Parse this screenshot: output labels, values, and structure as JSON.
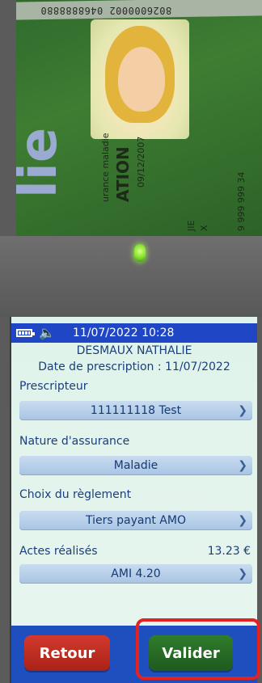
{
  "card": {
    "top_number": "8026000002 0468888880",
    "big_text": "lie",
    "rotated_texts": [
      "urance maladie",
      "ATION",
      "09/12/2007",
      "JIE",
      "X",
      "9 999 999 34"
    ]
  },
  "status_bar": {
    "battery_icon": "battery-icon",
    "speaker_icon": "speaker-icon",
    "datetime": "11/07/2022 10:28"
  },
  "patient": {
    "name": "DESMAUX NATHALIE",
    "prescription_date": "Date de prescription : 11/07/2022"
  },
  "fields": {
    "prescripteur": {
      "label": "Prescripteur",
      "value": "111111118 Test"
    },
    "nature": {
      "label": "Nature d'assurance",
      "value": "Maladie"
    },
    "reglement": {
      "label": "Choix du règlement",
      "value": "Tiers payant AMO"
    },
    "actes": {
      "label": "Actes réalisés",
      "amount": "13.23 €",
      "value": "AMI 4.20"
    }
  },
  "buttons": {
    "retour": "Retour",
    "valider": "Valider"
  },
  "colors": {
    "status_bar": "#1f46c4",
    "field": "#b6cfea",
    "retour": "#c12f23",
    "valider": "#276b25",
    "highlight": "#e32222"
  }
}
